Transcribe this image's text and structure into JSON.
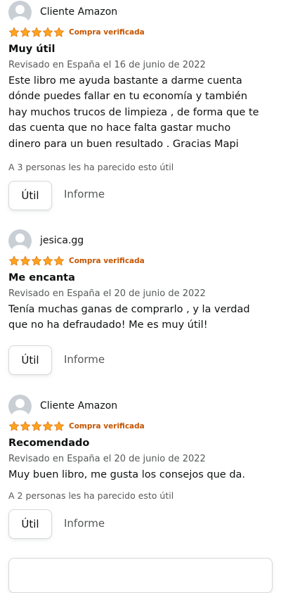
{
  "reviews": [
    {
      "author": "Cliente Amazon",
      "rating": 5,
      "verified": "Compra verificada",
      "title": "Muy útil",
      "date": "Revisado en España el 16 de junio de 2022",
      "body_lines": [
        "Este libro me ayuda bastante a darme cuenta",
        "dónde puedes fallar en tu economía y también",
        "hay muchos trucos de limpieza , de forma que te",
        "das cuenta que no hace falta gastar mucho",
        "dinero para un buen resultado . Gracias Mapi"
      ],
      "helpful": "A 3 personas les ha parecido esto útil",
      "helpful_button": "Útil",
      "report": "Informe"
    },
    {
      "author": "jesica.gg",
      "rating": 5,
      "verified": "Compra verificada",
      "title": "Me encanta",
      "date": "Revisado en España el 20 de junio de 2022",
      "body_lines": [
        "Tenía muchas ganas de comprarlo , y la verdad",
        "que no ha defraudado! Me es muy útil!"
      ],
      "helpful": "",
      "helpful_button": "Útil",
      "report": "Informe"
    },
    {
      "author": "Cliente Amazon",
      "rating": 5,
      "verified": "Compra verificada",
      "title": "Recomendado",
      "date": "Revisado en España el 20 de junio de 2022",
      "body_lines": [
        "Muy buen libro, me gusta los consejos que da."
      ],
      "helpful": "A 2 personas les ha parecido esto útil",
      "helpful_button": "Útil",
      "report": "Informe"
    }
  ],
  "colors": {
    "star": "#ffa41c",
    "verified": "#c45500",
    "text": "#0f1111",
    "muted": "#565959"
  },
  "icons": {
    "avatar": "default-user-avatar-icon",
    "star": "star-icon"
  }
}
